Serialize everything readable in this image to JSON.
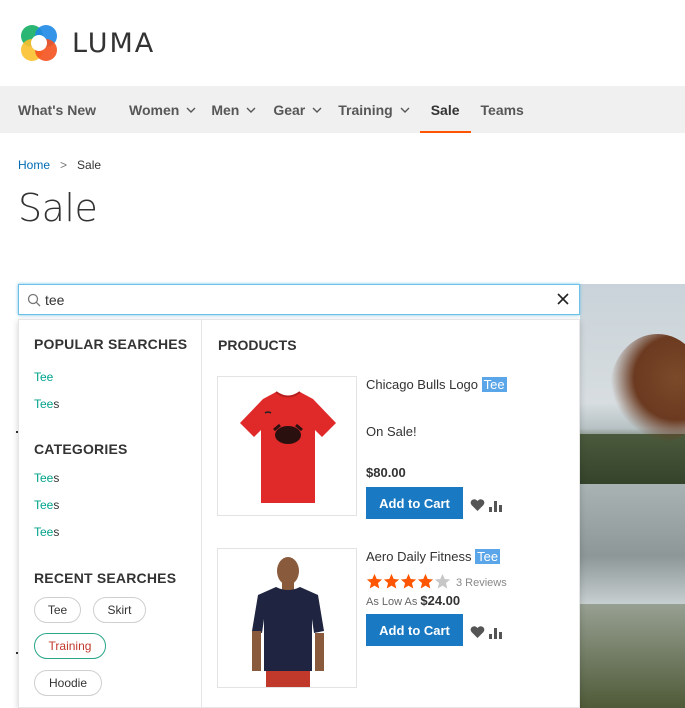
{
  "header": {
    "logo_text": "LUMA"
  },
  "nav": {
    "items": [
      {
        "label": "What's New",
        "has_chevron": false
      },
      {
        "label": "Women",
        "has_chevron": true
      },
      {
        "label": "Men",
        "has_chevron": true
      },
      {
        "label": "Gear",
        "has_chevron": true
      },
      {
        "label": "Training",
        "has_chevron": true
      },
      {
        "label": "Sale",
        "has_chevron": false,
        "active": true
      },
      {
        "label": "Teams",
        "has_chevron": false
      }
    ]
  },
  "breadcrumb": {
    "home": "Home",
    "separator": ">",
    "current": "Sale"
  },
  "page_title": "Sale",
  "search": {
    "value": "tee"
  },
  "dropdown": {
    "popular_title": "POPULAR SEARCHES",
    "popular": [
      {
        "match": "Tee",
        "rest": ""
      },
      {
        "match": "Tee",
        "rest": "s"
      }
    ],
    "categories_title": "CATEGORIES",
    "categories": [
      {
        "match": "Tee",
        "rest": "s"
      },
      {
        "match": "Tee",
        "rest": "s"
      },
      {
        "match": "Tee",
        "rest": "s"
      }
    ],
    "recent_title": "RECENT SEARCHES",
    "recent": [
      "Tee",
      "Skirt",
      "Training",
      "Hoodie"
    ],
    "products_title": "PRODUCTS",
    "products": [
      {
        "name_prefix": "Chicago Bulls Logo ",
        "name_highlight": "Tee",
        "badge": "On Sale!",
        "price": "$80.00",
        "add_to_cart": "Add to Cart"
      },
      {
        "name_prefix": "Aero Daily Fitness ",
        "name_highlight": "Tee",
        "rating_stars": 4,
        "reviews": "3 Reviews",
        "as_low_as": "As Low As",
        "price": "$24.00",
        "add_to_cart": "Add to Cart"
      }
    ]
  },
  "colors": {
    "accent": "#1979c3",
    "nav_active": "#ff5501",
    "highlight": "#5aa6e8",
    "match_text": "#00a28a",
    "star": "#ff5501"
  }
}
